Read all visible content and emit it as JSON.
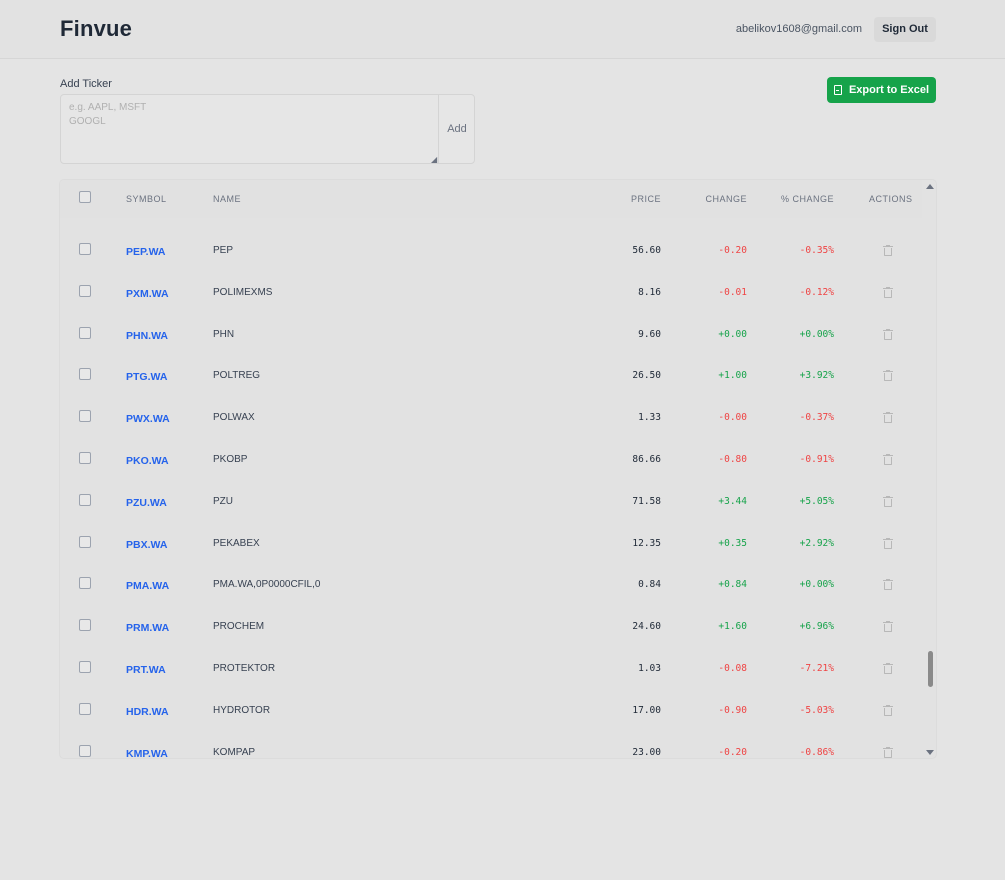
{
  "app": {
    "brand": "Finvue"
  },
  "header": {
    "user_email": "abelikov1608@gmail.com",
    "sign_out_label": "Sign Out"
  },
  "add_ticker": {
    "label": "Add Ticker",
    "placeholder": "e.g. AAPL, MSFT\nGOOGL",
    "add_label": "Add"
  },
  "export": {
    "label": "Export to Excel",
    "color": "#16a34a"
  },
  "table": {
    "columns": {
      "symbol": "SYMBOL",
      "name": "NAME",
      "price": "PRICE",
      "change": "CHANGE",
      "pct_change": "% CHANGE",
      "actions": "ACTIONS"
    },
    "rows": [
      {
        "symbol": "PEP.WA",
        "name": "PEP",
        "price": "56.60",
        "change": "-0.20",
        "pct": "-0.35%",
        "dir": "neg"
      },
      {
        "symbol": "PXM.WA",
        "name": "POLIMEXMS",
        "price": "8.16",
        "change": "-0.01",
        "pct": "-0.12%",
        "dir": "neg"
      },
      {
        "symbol": "PHN.WA",
        "name": "PHN",
        "price": "9.60",
        "change": "+0.00",
        "pct": "+0.00%",
        "dir": "pos"
      },
      {
        "symbol": "PTG.WA",
        "name": "POLTREG",
        "price": "26.50",
        "change": "+1.00",
        "pct": "+3.92%",
        "dir": "pos"
      },
      {
        "symbol": "PWX.WA",
        "name": "POLWAX",
        "price": "1.33",
        "change": "-0.00",
        "pct": "-0.37%",
        "dir": "neg"
      },
      {
        "symbol": "PKO.WA",
        "name": "PKOBP",
        "price": "86.66",
        "change": "-0.80",
        "pct": "-0.91%",
        "dir": "neg"
      },
      {
        "symbol": "PZU.WA",
        "name": "PZU",
        "price": "71.58",
        "change": "+3.44",
        "pct": "+5.05%",
        "dir": "pos"
      },
      {
        "symbol": "PBX.WA",
        "name": "PEKABEX",
        "price": "12.35",
        "change": "+0.35",
        "pct": "+2.92%",
        "dir": "pos"
      },
      {
        "symbol": "PMA.WA",
        "name": "PMA.WA,0P0000CFIL,0",
        "price": "0.84",
        "change": "+0.84",
        "pct": "+0.00%",
        "dir": "pos"
      },
      {
        "symbol": "PRM.WA",
        "name": "PROCHEM",
        "price": "24.60",
        "change": "+1.60",
        "pct": "+6.96%",
        "dir": "pos"
      },
      {
        "symbol": "PRT.WA",
        "name": "PROTEKTOR",
        "price": "1.03",
        "change": "-0.08",
        "pct": "-7.21%",
        "dir": "neg"
      },
      {
        "symbol": "HDR.WA",
        "name": "HYDROTOR",
        "price": "17.00",
        "change": "-0.90",
        "pct": "-5.03%",
        "dir": "neg"
      },
      {
        "symbol": "KMP.WA",
        "name": "KOMPAP",
        "price": "23.00",
        "change": "-0.20",
        "pct": "-0.86%",
        "dir": "neg"
      }
    ]
  },
  "colors": {
    "positive": "#16a34a",
    "negative": "#ef4444",
    "link": "#2563eb"
  }
}
